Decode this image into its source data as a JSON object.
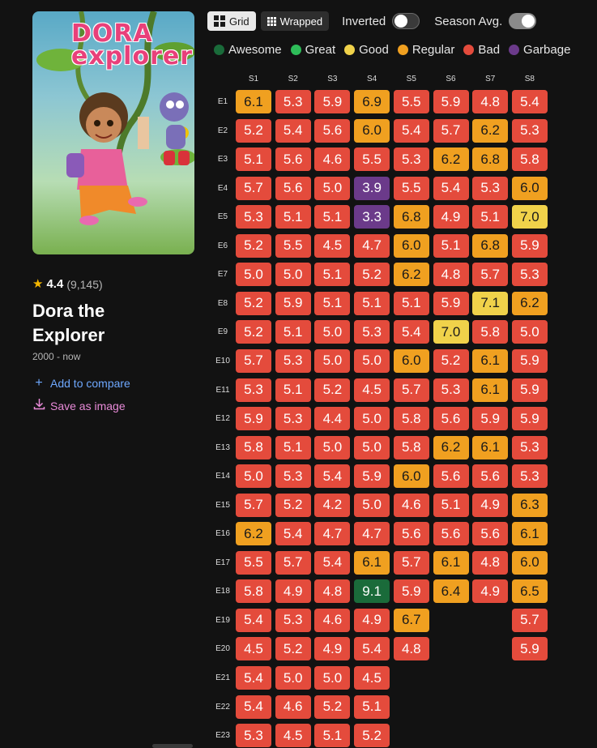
{
  "show": {
    "rating": "4.4",
    "votes": "(9,145)",
    "title": "Dora the Explorer",
    "years": "2000 - now",
    "add_compare": "Add to compare",
    "save_image": "Save as image",
    "poster_logo": "DORA explorer"
  },
  "toolbar": {
    "grid_label": "Grid",
    "wrapped_label": "Wrapped",
    "inverted_label": "Inverted",
    "inverted_on": false,
    "season_avg_label": "Season Avg.",
    "season_avg_on": true
  },
  "legend": [
    {
      "label": "Awesome",
      "color": "#1a6b3a"
    },
    {
      "label": "Great",
      "color": "#2ebd59"
    },
    {
      "label": "Good",
      "color": "#f0d24a"
    },
    {
      "label": "Regular",
      "color": "#f0a020"
    },
    {
      "label": "Bad",
      "color": "#e44b3c"
    },
    {
      "label": "Garbage",
      "color": "#6b3a8a"
    }
  ],
  "seasons": [
    "S1",
    "S2",
    "S3",
    "S4",
    "S5",
    "S6",
    "S7",
    "S8"
  ],
  "episodes": [
    "E1",
    "E2",
    "E3",
    "E4",
    "E5",
    "E6",
    "E7",
    "E8",
    "E9",
    "E10",
    "E11",
    "E12",
    "E13",
    "E14",
    "E15",
    "E16",
    "E17",
    "E18",
    "E19",
    "E20",
    "E21",
    "E22",
    "E23"
  ],
  "ratings": [
    [
      6.1,
      5.3,
      5.9,
      6.9,
      5.5,
      5.9,
      4.8,
      5.4
    ],
    [
      5.2,
      5.4,
      5.6,
      6.0,
      5.4,
      5.7,
      6.2,
      5.3
    ],
    [
      5.1,
      5.6,
      4.6,
      5.5,
      5.3,
      6.2,
      6.8,
      5.8
    ],
    [
      5.7,
      5.6,
      5.0,
      3.9,
      5.5,
      5.4,
      5.3,
      6.0
    ],
    [
      5.3,
      5.1,
      5.1,
      3.3,
      6.8,
      4.9,
      5.1,
      7.0
    ],
    [
      5.2,
      5.5,
      4.5,
      4.7,
      6.0,
      5.1,
      6.8,
      5.9
    ],
    [
      5.0,
      5.0,
      5.1,
      5.2,
      6.2,
      4.8,
      5.7,
      5.3
    ],
    [
      5.2,
      5.9,
      5.1,
      5.1,
      5.1,
      5.9,
      7.1,
      6.2
    ],
    [
      5.2,
      5.1,
      5.0,
      5.3,
      5.4,
      7.0,
      5.8,
      5.0
    ],
    [
      5.7,
      5.3,
      5.0,
      5.0,
      6.0,
      5.2,
      6.1,
      5.9
    ],
    [
      5.3,
      5.1,
      5.2,
      4.5,
      5.7,
      5.3,
      6.1,
      5.9
    ],
    [
      5.9,
      5.3,
      4.4,
      5.0,
      5.8,
      5.6,
      5.9,
      5.9
    ],
    [
      5.8,
      5.1,
      5.0,
      5.0,
      5.8,
      6.2,
      6.1,
      5.3
    ],
    [
      5.0,
      5.3,
      5.4,
      5.9,
      6.0,
      5.6,
      5.6,
      5.3
    ],
    [
      5.7,
      5.2,
      4.2,
      5.0,
      4.6,
      5.1,
      4.9,
      6.3
    ],
    [
      6.2,
      5.4,
      4.7,
      4.7,
      5.6,
      5.6,
      5.6,
      6.1
    ],
    [
      5.5,
      5.7,
      5.4,
      6.1,
      5.7,
      6.1,
      4.8,
      6.0
    ],
    [
      5.8,
      4.9,
      4.8,
      9.1,
      5.9,
      6.4,
      4.9,
      6.5
    ],
    [
      5.4,
      5.3,
      4.6,
      4.9,
      6.7,
      null,
      null,
      5.7
    ],
    [
      4.5,
      5.2,
      4.9,
      5.4,
      4.8,
      null,
      null,
      5.9
    ],
    [
      5.4,
      5.0,
      5.0,
      4.5,
      null,
      null,
      null,
      null
    ],
    [
      5.4,
      4.6,
      5.2,
      5.1,
      null,
      null,
      null,
      null
    ],
    [
      5.3,
      4.5,
      5.1,
      5.2,
      null,
      null,
      null,
      null
    ]
  ]
}
